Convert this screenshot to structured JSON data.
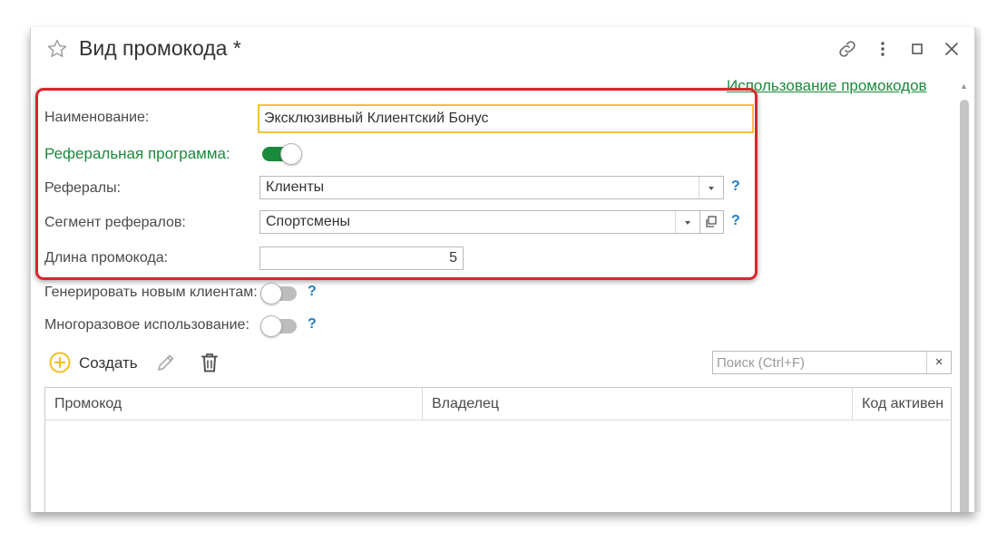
{
  "window": {
    "title": "Вид промокода *",
    "usage_link": "Использование промокодов"
  },
  "form": {
    "name_label": "Наименование:",
    "name_value": "Эксклюзивный Клиентский Бонус",
    "referral_label": "Реферальная программа:",
    "referral_on": true,
    "referrals_label": "Рефералы:",
    "referrals_value": "Клиенты",
    "segment_label": "Сегмент рефералов:",
    "segment_value": "Спортсмены",
    "length_label": "Длина промокода:",
    "length_value": "5",
    "gen_new_label": "Генерировать новым клиентам:",
    "gen_new_on": false,
    "multi_use_label": "Многоразовое использование:",
    "multi_use_on": false,
    "help_mark": "?"
  },
  "toolbar": {
    "create_label": "Создать",
    "search_placeholder": "Поиск (Ctrl+F)",
    "clear_symbol": "×"
  },
  "table": {
    "columns": [
      "Промокод",
      "Владелец",
      "Код активен"
    ]
  },
  "colors": {
    "accent_green": "#1a8a3c",
    "highlight_red": "#d8262c",
    "focus_yellow": "#f0c23a",
    "help_blue": "#1f7cc1",
    "create_yellow": "#f2c01e"
  },
  "icons": {
    "favorite": "star-icon",
    "link": "link-icon",
    "more": "more-vertical-icon",
    "maximize": "maximize-icon",
    "close": "close-icon",
    "create": "plus-circle-icon",
    "edit": "pencil-icon",
    "delete": "trash-icon"
  }
}
